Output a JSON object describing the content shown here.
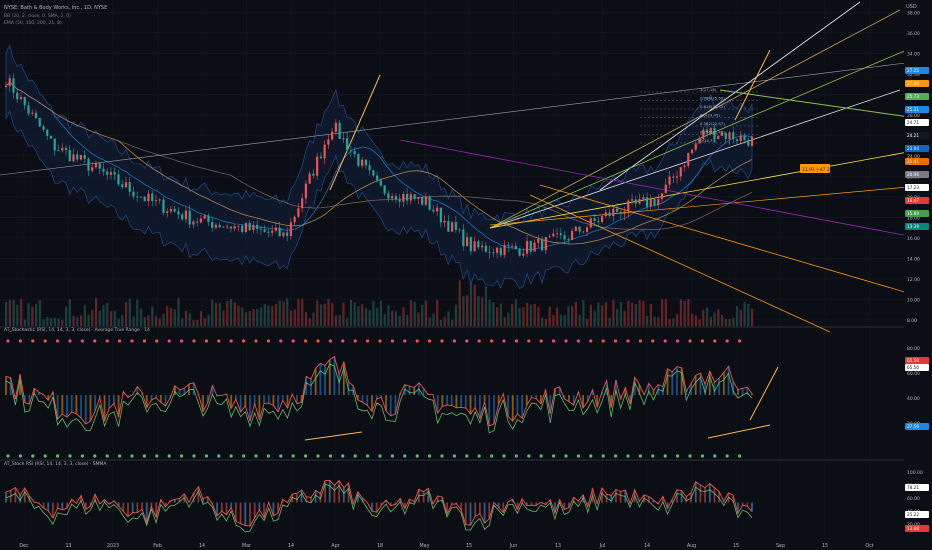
{
  "header": {
    "title_line": "NYSE: Bath & Body Works, Inc., 1D, NYSE",
    "indicator_line_1": "BB (20, 2, close, 0, SMA, 2, 0)",
    "indicator_line_2": "EMA (50, 100, 200, 21, 8)"
  },
  "price_axis": {
    "currency": "USD",
    "labels": [
      "38.00",
      "36.00",
      "34.00",
      "32.00",
      "30.00",
      "28.00",
      "26.00",
      "24.00",
      "22.00",
      "20.00",
      "18.00",
      "16.00",
      "14.00",
      "12.00",
      "10.00",
      "8.00"
    ],
    "badges": [
      {
        "text": "27.25",
        "color": "#1e88e5"
      },
      {
        "text": "27.00",
        "color": "#ff9800"
      },
      {
        "text": "25.73",
        "color": "#4caf50"
      },
      {
        "text": "25.21",
        "color": "#1e88e5"
      },
      {
        "text": "24.71",
        "color": "#ffffff"
      },
      {
        "text": "24.21",
        "color": "#131722"
      },
      {
        "text": "23.04",
        "color": "#1565c0"
      },
      {
        "text": "21.41",
        "color": "#ef6c00"
      },
      {
        "text": "20.96",
        "color": "#787b86"
      },
      {
        "text": "17.23",
        "color": "#ffffff"
      },
      {
        "text": "16.47",
        "color": "#e53935"
      },
      {
        "text": "15.89",
        "color": "#43a047"
      },
      {
        "text": "13.39",
        "color": "#00897b"
      }
    ]
  },
  "x_axis": {
    "labels": [
      "Dec",
      "13",
      "2023",
      "Feb",
      "14",
      "Mar",
      "14",
      "Apr",
      "18",
      "May",
      "15",
      "Jun",
      "13",
      "Jul",
      "14",
      "Aug",
      "15",
      "Sep",
      "15",
      "Oct"
    ]
  },
  "annotations": {
    "fib_labels": [
      "1(27.18)",
      "0.786(25.58)",
      "0.618(24.33)",
      "0.5(23.45)",
      "0.382(22.57)",
      "0.236(21.48)",
      "0(19.73)"
    ],
    "measure_label": "11.91 (-47.29%)"
  },
  "osc1": {
    "title": "AT_Stochastic (RSI, 14, 14, 3, 3, close) · Average True Range · 14",
    "axis": [
      "80.00",
      "60.00",
      "40.00",
      "20.00"
    ],
    "badges": [
      {
        "text": "65.50",
        "color": "#e53935"
      },
      {
        "text": "65.50",
        "color": "#ffffff"
      },
      {
        "text": "37.56",
        "color": "#1e88e5"
      }
    ]
  },
  "osc2": {
    "title": "AT_Stoch RSI (RSI, 14, 14, 3, 3, close) · SMMA",
    "axis": [
      "100.00",
      "80.00",
      "60.00",
      "40.00",
      "20.00"
    ],
    "badges": [
      {
        "text": "78.21",
        "color": "#ffffff"
      },
      {
        "text": "25.22",
        "color": "#ffffff"
      },
      {
        "text": "13.08",
        "color": "#e53935"
      }
    ]
  },
  "colors": {
    "background": "#0b0e14",
    "up": "#ef5350",
    "down": "#26a69a",
    "bb": "#1e4d8c",
    "orange": "#ff9800",
    "green": "#4caf50",
    "white": "#e0e3eb"
  },
  "chart_data": {
    "type": "line",
    "title": "",
    "xlabel": "",
    "ylabel": "",
    "ylim": [
      7.5,
      39
    ],
    "x": [
      "Dec",
      "13",
      "2023",
      "Feb",
      "14",
      "Mar",
      "14",
      "Apr",
      "18",
      "May",
      "15",
      "Jun",
      "13",
      "Jul",
      "14",
      "Aug",
      "15"
    ],
    "series": [
      {
        "name": "close",
        "values": [
          31.5,
          25.0,
          22.5,
          19.8,
          17.8,
          17.0,
          16.2,
          27.0,
          20.8,
          19.5,
          15.0,
          14.9,
          16.0,
          18.5,
          19.8,
          26.5,
          25.5
        ]
      }
    ],
    "osc1_values": [
      65,
      40,
      33,
      48,
      52,
      37,
      45,
      80,
      42,
      50,
      30,
      40,
      48,
      52,
      60,
      72,
      65
    ],
    "osc2_values": [
      70,
      40,
      55,
      30,
      68,
      20,
      45,
      82,
      35,
      62,
      25,
      55,
      40,
      70,
      45,
      80,
      25
    ]
  }
}
